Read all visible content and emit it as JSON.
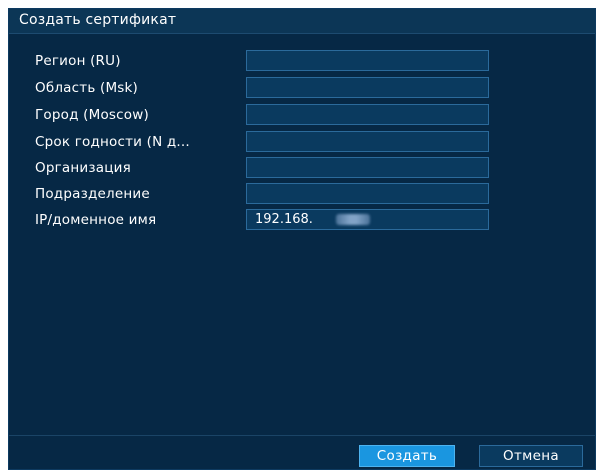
{
  "dialog": {
    "title": "Создать сертификат"
  },
  "form": {
    "fields": [
      {
        "label": "Регион (RU)",
        "value": ""
      },
      {
        "label": "Область (Msk)",
        "value": ""
      },
      {
        "label": "Город (Moscow)",
        "value": ""
      },
      {
        "label": "Срок годности (N д...",
        "value": ""
      },
      {
        "label": "Организация",
        "value": ""
      },
      {
        "label": "Подразделение",
        "value": ""
      },
      {
        "label": "IP/доменное имя",
        "value": "192.168."
      }
    ]
  },
  "footer": {
    "create_label": "Создать",
    "cancel_label": "Отмена"
  },
  "colors": {
    "background": "#062845",
    "titlebar": "#0c3656",
    "input_border": "#2b6a9b",
    "primary_button": "#1a96e0"
  }
}
